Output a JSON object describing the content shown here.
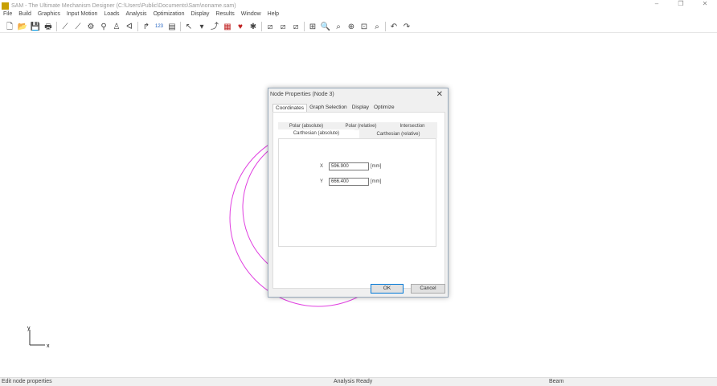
{
  "window": {
    "title": "SAM - The Ultimate Mechanism Designer (C:\\Users\\Public\\Documents\\Sam\\noname.sam)",
    "minimize": "–",
    "maximize": "❐",
    "close": "✕"
  },
  "menu": [
    "File",
    "Build",
    "Graphics",
    "Input Motion",
    "Loads",
    "Analysis",
    "Optimization",
    "Display",
    "Results",
    "Window",
    "Help"
  ],
  "toolbar": [
    "new-icon",
    "open-icon",
    "save-icon",
    "print-icon",
    "beam-icon",
    "slider-icon",
    "gear-icon",
    "belt-icon",
    "ground-icon",
    "spring-icon",
    "curve-icon",
    "numbers-icon",
    "table-icon",
    "pointer-icon",
    "dropdown-icon",
    "motion-icon",
    "film-icon",
    "heart-icon",
    "bug-icon",
    "graph1-icon",
    "graph2-icon",
    "graph3-icon",
    "zoom-fit-icon",
    "zoom-icon",
    "zoom-pan-icon",
    "zoom-in-icon",
    "zoom-window-icon",
    "zoom-extents-icon",
    "undo-icon",
    "redo-icon"
  ],
  "toolbar_glyphs": [
    "🗋",
    "📂",
    "💾",
    "🖶",
    "⟋",
    "⟋",
    "⚙",
    "⚲",
    "♙",
    "ᐊ",
    "↱",
    "123",
    "▤",
    "↖",
    "▾",
    "⤴",
    "▦",
    "♥",
    "✱",
    "⧄",
    "⧄",
    "⧄",
    "⊞",
    "🔍",
    "⌕",
    "⊕",
    "⊡",
    "⌕",
    "↶",
    "↷"
  ],
  "status": {
    "left": "Edit node properties",
    "center": "Analysis Ready",
    "right": "Beam"
  },
  "axes": {
    "x": "x",
    "y": "y"
  },
  "colors": {
    "curve": "#e040e0",
    "ok_border": "#0078d7"
  },
  "dialog": {
    "title": "Node Properties (Node 3)",
    "close": "✕",
    "tabs": [
      "Coordinates",
      "Graph Selection",
      "Display",
      "Optimize"
    ],
    "subtabs_row1": [
      "Polar (absolute)",
      "Polar (relative)",
      "Intersection"
    ],
    "subtabs_row2": [
      "Carthesian (absolute)",
      "Carthesian (relative)"
    ],
    "x_label": "X",
    "x_value": "596.900",
    "x_unit": "[mm]",
    "y_label": "Y",
    "y_value": "666.400",
    "y_unit": "[mm]",
    "ok": "OK",
    "cancel": "Cancel"
  }
}
